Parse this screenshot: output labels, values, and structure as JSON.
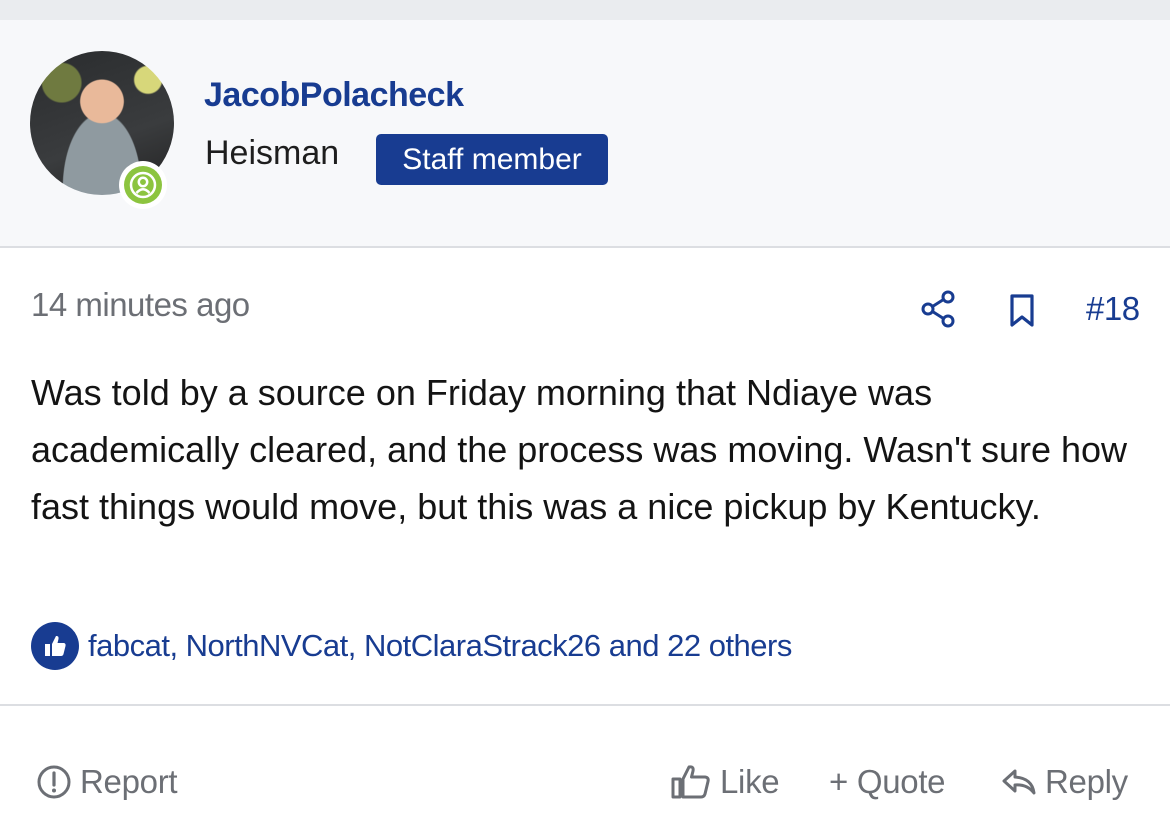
{
  "user": {
    "name": "JacobPolacheck",
    "title": "Heisman",
    "badge": "Staff member",
    "status_color": "#8cc43f"
  },
  "post": {
    "timestamp": "14 minutes ago",
    "number": "#18",
    "body": "Was told by a source on Friday morning that Ndiaye was academically cleared, and the process was moving. Wasn't sure how fast things would move, but this was a nice pickup by Kentucky.",
    "reactions": "fabcat, NorthNVCat, NotClaraStrack26 and 22 others"
  },
  "actions": {
    "report": "Report",
    "like": "Like",
    "quote": "+ Quote",
    "reply": "Reply"
  },
  "colors": {
    "accent": "#183c91",
    "muted_text": "#6c6f75",
    "header_bg": "#f7f8fa"
  },
  "icons": {
    "share": "share-icon",
    "bookmark": "bookmark-icon",
    "like_badge": "thumbs-up-icon",
    "report": "alert-circle-icon",
    "like": "thumbs-up-outline-icon",
    "reply": "reply-arrow-icon",
    "online": "user-online-icon"
  }
}
